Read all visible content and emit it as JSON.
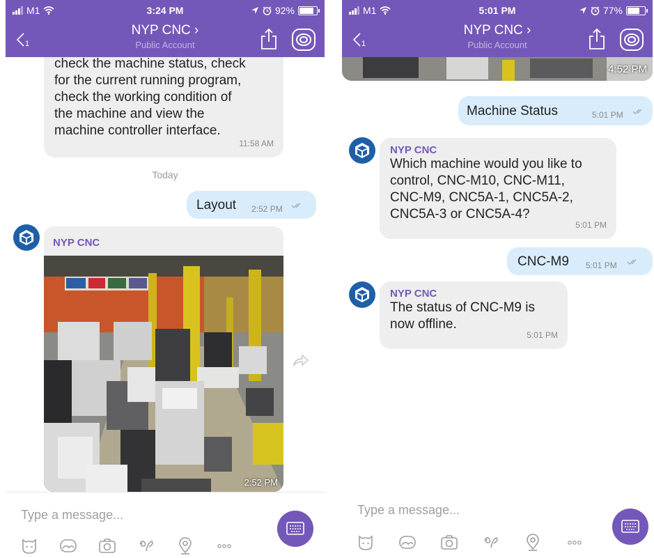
{
  "left": {
    "status": {
      "carrier": "M1",
      "time": "3:24 PM",
      "battery": "92%",
      "battery_level": 0.92
    },
    "nav": {
      "title": "NYP CNC ›",
      "subtitle": "Public Account"
    },
    "messages": {
      "intro_text": [
        "check the machine status, check",
        "for the current running program,",
        "check the working condition of",
        "the machine and view the",
        "machine controller interface."
      ],
      "intro_time": "11:58 AM",
      "day": "Today",
      "layout_text": "Layout",
      "layout_time": "2:52 PM",
      "photo_sender": "NYP CNC",
      "photo_time": "2:52 PM"
    },
    "composer": {
      "placeholder": "Type a message..."
    }
  },
  "right": {
    "status": {
      "carrier": "M1",
      "time": "5:01 PM",
      "battery": "77%",
      "battery_level": 0.77
    },
    "nav": {
      "title": "NYP CNC ›",
      "subtitle": "Public Account"
    },
    "messages": {
      "prev_photo_time": "4:52 PM",
      "status_text": "Machine Status",
      "status_time": "5:01 PM",
      "q_sender": "NYP CNC",
      "q_text": [
        "Which machine would you like to",
        "control, CNC-M10, CNC-M11,",
        "CNC-M9, CNC5A-1, CNC5A-2,",
        "CNC5A-3 or CNC5A-4?"
      ],
      "q_time": "5:01 PM",
      "m9_text": "CNC-M9",
      "m9_time": "5:01 PM",
      "a_sender": "NYP CNC",
      "a_text": [
        "The status of CNC-M9 is",
        "now offline."
      ],
      "a_time": "5:01 PM"
    },
    "composer": {
      "placeholder": "Type a message..."
    }
  },
  "colors": {
    "accent": "#7458b9",
    "incoming": "#eeeeee",
    "outgoing": "#d8ecfb",
    "avatar": "#1f5fa8"
  },
  "icons": [
    "signal-icon",
    "wifi-icon",
    "location-icon",
    "alarm-icon",
    "battery-icon",
    "back-icon",
    "share-icon",
    "viber-icon",
    "bot-avatar-icon",
    "forward-icon",
    "keyboard-icon",
    "sticker-icon",
    "gallery-icon",
    "camera-icon",
    "doodle-icon",
    "location-pin-icon",
    "more-icon"
  ]
}
